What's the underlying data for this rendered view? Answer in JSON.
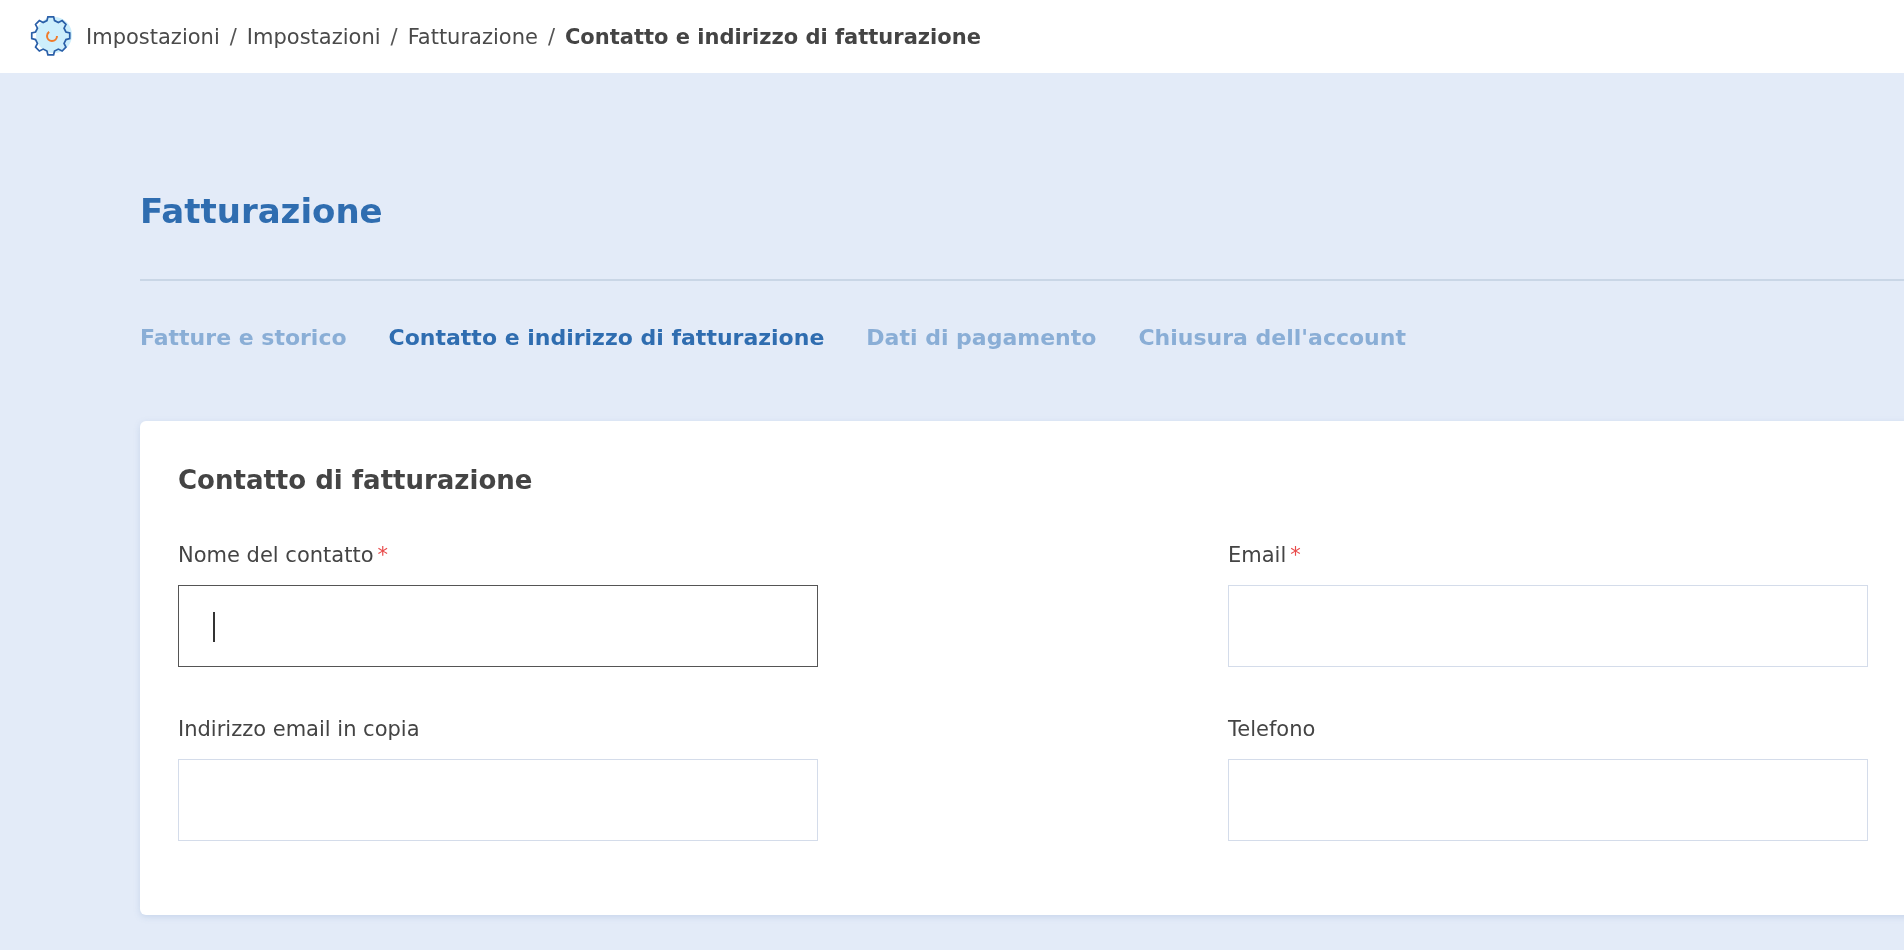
{
  "breadcrumb": [
    {
      "label": "Impostazioni",
      "current": false
    },
    {
      "label": "Impostazioni",
      "current": false
    },
    {
      "label": "Fatturazione",
      "current": false
    },
    {
      "label": "Contatto e indirizzo di fatturazione",
      "current": true
    }
  ],
  "breadcrumb_separator": "/",
  "page_title": "Fatturazione",
  "tabs": [
    {
      "label": "Fatture e storico",
      "selected": false
    },
    {
      "label": "Contatto e indirizzo di fatturazione",
      "selected": true
    },
    {
      "label": "Dati di pagamento",
      "selected": false
    },
    {
      "label": "Chiusura dell'account",
      "selected": false
    }
  ],
  "card": {
    "title": "Contatto di fatturazione",
    "required_mark": "*",
    "fields": [
      {
        "label": "Nome del contatto",
        "required": true,
        "focused": true
      },
      {
        "label": "Email",
        "required": true,
        "focused": false
      },
      {
        "label": "Indirizzo email in copia",
        "required": false,
        "focused": false
      },
      {
        "label": "Telefono",
        "required": false,
        "focused": false
      }
    ]
  }
}
